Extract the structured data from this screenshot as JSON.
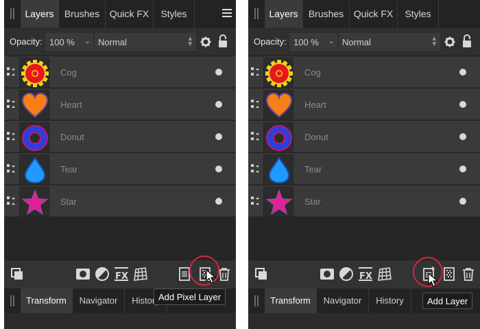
{
  "panels": [
    {
      "tabs": [
        "Layers",
        "Brushes",
        "Quick FX",
        "Styles"
      ],
      "opacity_label": "Opacity:",
      "opacity_value": "100 %",
      "blend_mode": "Normal",
      "layers": [
        "Cog",
        "Heart",
        "Donut",
        "Tear",
        "Star"
      ],
      "bottom_tabs": [
        "Transform",
        "Navigator",
        "History"
      ],
      "tooltip": "Add Pixel Layer"
    },
    {
      "tabs": [
        "Layers",
        "Brushes",
        "Quick FX",
        "Styles"
      ],
      "opacity_label": "Opacity:",
      "opacity_value": "100 %",
      "blend_mode": "Normal",
      "layers": [
        "Cog",
        "Heart",
        "Donut",
        "Tear",
        "Star"
      ],
      "bottom_tabs": [
        "Transform",
        "Navigator",
        "History"
      ],
      "tooltip": "Add Layer"
    }
  ],
  "colors": {
    "highlight_ring": "#d8253e",
    "cog_fill": "#e8161e",
    "cog_outline": "#f2d21a",
    "heart_fill": "#f77f16",
    "donut_fill": "#2b3fe0",
    "tear_fill": "#1f9aff",
    "star_fill": "#e0209a"
  },
  "icons": [
    "drag-grip-icon",
    "panel-menu-icon",
    "gear-icon",
    "lock-icon",
    "duplicate-icon",
    "mask-icon",
    "adjustment-icon",
    "fx-icon",
    "live-filter-icon",
    "add-layer-icon",
    "add-pixel-layer-icon",
    "trash-icon"
  ]
}
